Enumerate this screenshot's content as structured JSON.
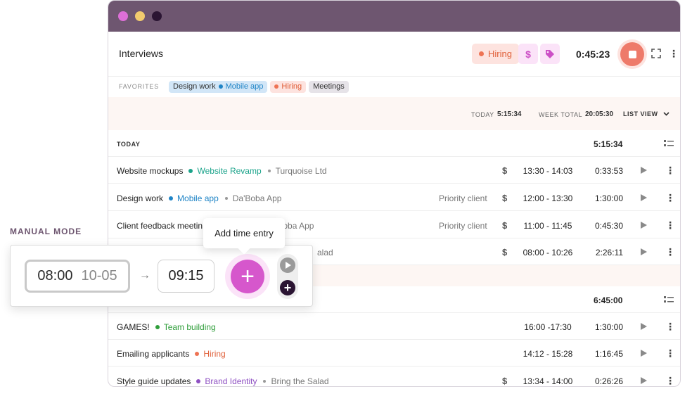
{
  "window": {
    "colors": {
      "titlebar": "#6e5670",
      "accent": "#d657cc",
      "stop": "#ee7a6a"
    }
  },
  "tracker": {
    "description": "Interviews",
    "project": "Hiring",
    "billable_icon": "$",
    "tag_icon": "tag-icon",
    "timer": "0:45:23"
  },
  "favorites": {
    "label": "FAVORITES",
    "items": [
      {
        "description": "Design work",
        "project": "Mobile app"
      },
      {
        "project": "Hiring"
      },
      {
        "project": "Meetings"
      }
    ]
  },
  "summary": {
    "today_label": "TODAY",
    "today_value": "5:15:34",
    "week_label": "WEEK TOTAL",
    "week_value": "20:05:30",
    "view_label": "LIST VIEW"
  },
  "groups": [
    {
      "label": "TODAY",
      "total": "5:15:34",
      "entries": [
        {
          "description": "Website mockups",
          "project": "Website Revamp",
          "project_color": "#1aa38a",
          "client": "Turquoise Ltd",
          "tag": "",
          "billable": "$",
          "range": "13:30 - 14:03",
          "duration": "0:33:53"
        },
        {
          "description": "Design work",
          "project": "Mobile app",
          "project_color": "#1f84c6",
          "client": "Da'Boba App",
          "tag": "Priority client",
          "billable": "$",
          "range": "12:00 - 13:30",
          "duration": "1:30:00"
        },
        {
          "description": "Client feedback meetin",
          "project": "",
          "project_color": "",
          "client": "'Boba App",
          "tag": "Priority client",
          "billable": "$",
          "range": "11:00 - 11:45",
          "duration": "0:45:30"
        },
        {
          "description": "",
          "project": "",
          "project_color": "",
          "client": "alad",
          "tag": "",
          "billable": "$",
          "range": "08:00 - 10:26",
          "duration": "2:26:11"
        }
      ]
    },
    {
      "label": "",
      "total": "6:45:00",
      "entries": [
        {
          "description": "GAMES!",
          "project": "Team building",
          "project_color": "#2f9e3a",
          "client": "",
          "tag": "",
          "billable": "",
          "range": "16:00 -17:30",
          "duration": "1:30:00"
        },
        {
          "description": "Emailing applicants",
          "project": "Hiring",
          "project_color": "#e0603a",
          "client": "",
          "tag": "",
          "billable": "",
          "range": "14:12 - 15:28",
          "duration": "1:16:45"
        },
        {
          "description": "Style guide updates",
          "project": "Brand Identity",
          "project_color": "#8e4fc2",
          "client": "Bring the Salad",
          "tag": "",
          "billable": "$",
          "range": "13:34 - 14:00",
          "duration": "0:26:26"
        }
      ]
    }
  ],
  "manual": {
    "label": "MANUAL MODE",
    "start_time": "08:00",
    "start_date": "10-05",
    "arrow": "→",
    "end_time": "09:15",
    "add_tooltip": "Add time entry"
  }
}
